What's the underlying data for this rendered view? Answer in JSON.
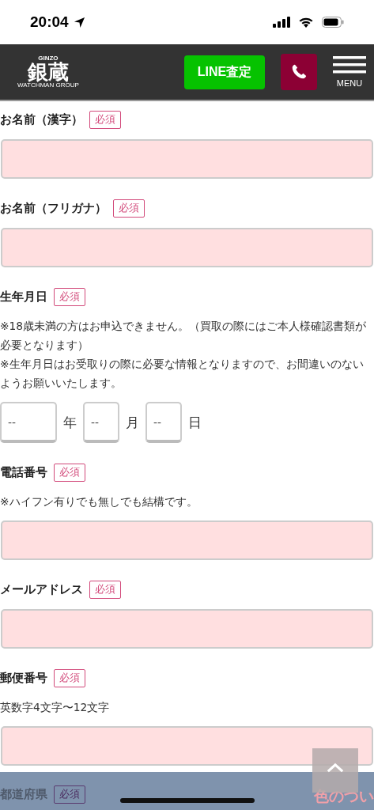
{
  "status_bar": {
    "time": "20:04"
  },
  "header": {
    "logo": {
      "top": "GINZO",
      "main": "銀蔵",
      "bottom": "WATCHMAN GROUP"
    },
    "line_button": "LINE査定",
    "menu_label": "MENU"
  },
  "fields": [
    {
      "kind": "text",
      "label": "お名前（漢字）",
      "badge": "必須"
    },
    {
      "kind": "text",
      "label": "お名前（フリガナ）",
      "badge": "必須"
    },
    {
      "kind": "date",
      "label": "生年月日",
      "badge": "必須",
      "notes": [
        "※18歳未満の方はお申込できません。（買取の際にはご本人様確認書類が必要となります）",
        "※生年月日はお受取りの際に必要な情報となりますので、お間違いのないようお願いいたします。"
      ],
      "parts": [
        {
          "placeholder": "--",
          "unit": "年"
        },
        {
          "placeholder": "--",
          "unit": "月"
        },
        {
          "placeholder": "--",
          "unit": "日"
        }
      ]
    },
    {
      "kind": "text",
      "label": "電話番号",
      "badge": "必須",
      "notes": [
        "※ハイフン有りでも無しでも結構です。"
      ]
    },
    {
      "kind": "text",
      "label": "メールアドレス",
      "badge": "必須"
    },
    {
      "kind": "text",
      "label": "郵便番号",
      "badge": "必須",
      "notes": [
        "英数字4文字〜12文字"
      ]
    }
  ],
  "bottom_band": {
    "label": "都道府県",
    "badge": "必須",
    "side_text": "色のつい"
  }
}
